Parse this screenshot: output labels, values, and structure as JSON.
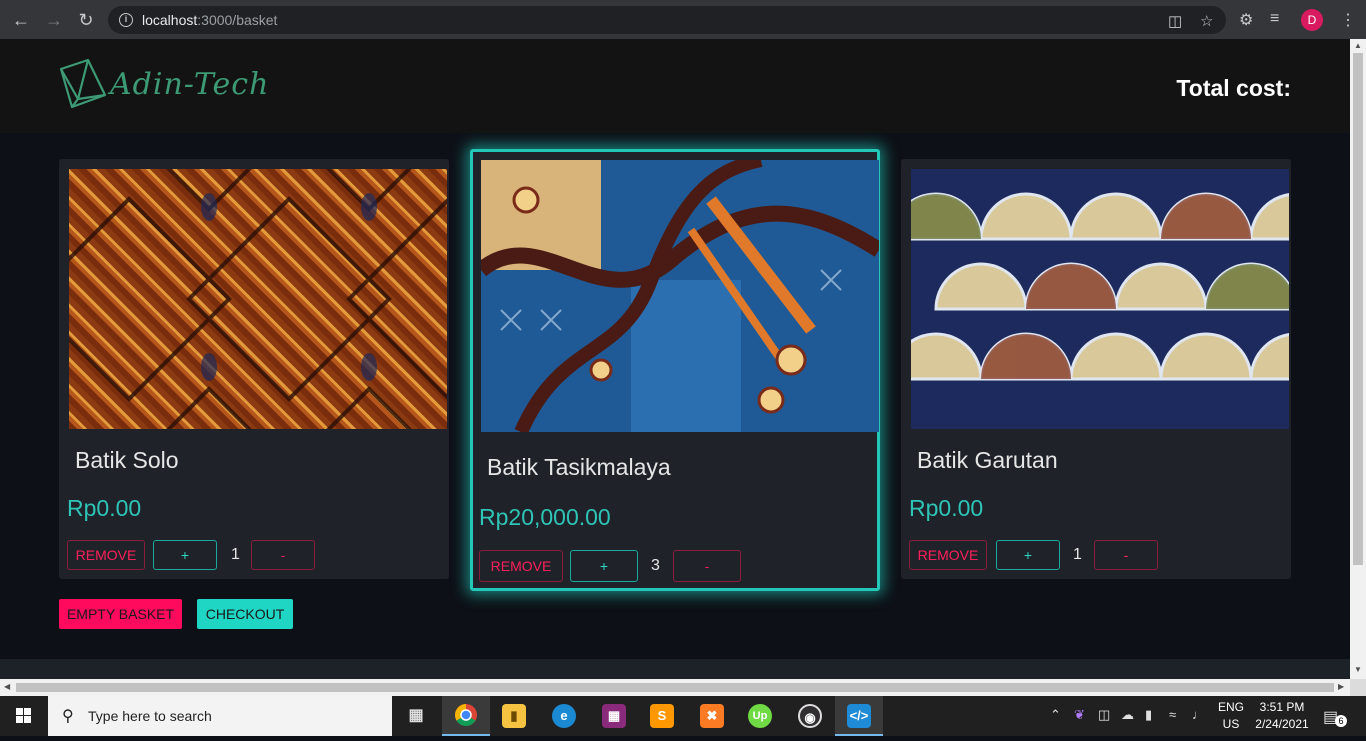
{
  "browser": {
    "url_host": "localhost",
    "url_path": ":3000/basket",
    "profile_initial": "D"
  },
  "header": {
    "logo_text": "Adin-Tech",
    "total_label": "Total cost:"
  },
  "basket": {
    "items": [
      {
        "name": "Batik Solo",
        "price": "Rp0.00",
        "quantity": "1",
        "remove_label": "REMOVE",
        "plus_label": "+",
        "minus_label": "-"
      },
      {
        "name": "Batik Tasikmalaya",
        "price": "Rp20,000.00",
        "quantity": "3",
        "remove_label": "REMOVE",
        "plus_label": "+",
        "minus_label": "-"
      },
      {
        "name": "Batik Garutan",
        "price": "Rp0.00",
        "quantity": "1",
        "remove_label": "REMOVE",
        "plus_label": "+",
        "minus_label": "-"
      }
    ],
    "empty_label": "EMPTY BASKET",
    "checkout_label": "CHECKOUT"
  },
  "colors": {
    "accent_teal": "#2ec4b6",
    "danger_pink": "#ff1f5a",
    "empty_button": "#ff0a5c",
    "checkout_button": "#1fd6c4"
  },
  "taskbar": {
    "search_placeholder": "Type here to search",
    "lang_top": "ENG",
    "lang_bottom": "US",
    "time": "3:51 PM",
    "date": "2/24/2021",
    "notification_count": "6",
    "apps": [
      "task-view-icon",
      "chrome-icon",
      "file-explorer-icon",
      "edge-icon",
      "winrar-icon",
      "sublime-text-icon",
      "xampp-icon",
      "upwork-icon",
      "obs-icon",
      "vscode-icon"
    ]
  }
}
